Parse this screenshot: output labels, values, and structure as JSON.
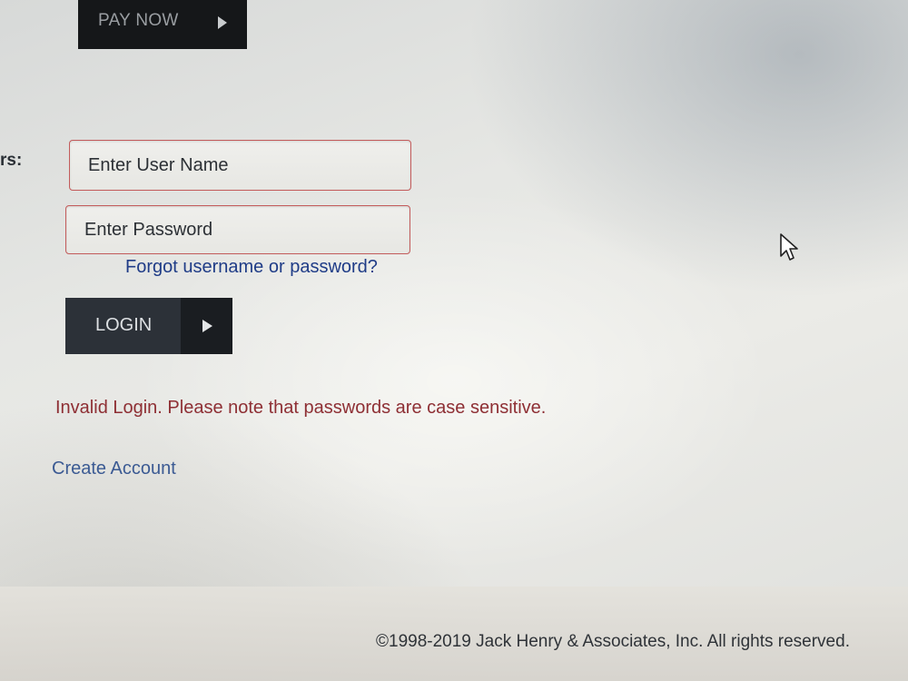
{
  "pay_now": {
    "label": "PAY NOW",
    "arrow_icon": "play-arrow-icon"
  },
  "login_form": {
    "section_label_fragment": "rs:",
    "username": {
      "placeholder": "Enter User Name",
      "value": ""
    },
    "password": {
      "placeholder": "Enter Password",
      "value": ""
    },
    "forgot_link": "Forgot username or password?",
    "login_button": {
      "label": "LOGIN",
      "arrow_icon": "play-arrow-icon"
    },
    "error_message": "Invalid Login. Please note that passwords are case sensitive.",
    "create_account_link": "Create Account"
  },
  "footer": {
    "copyright": "©1998-2019 Jack Henry & Associates, Inc. All rights reserved."
  },
  "colors": {
    "button_dark": "#2c3138",
    "field_border": "#c35b5b",
    "link_blue": "#1f3c87",
    "error_red": "#8e2f34"
  },
  "icons": [
    "play-arrow-icon",
    "mouse-pointer-icon"
  ]
}
